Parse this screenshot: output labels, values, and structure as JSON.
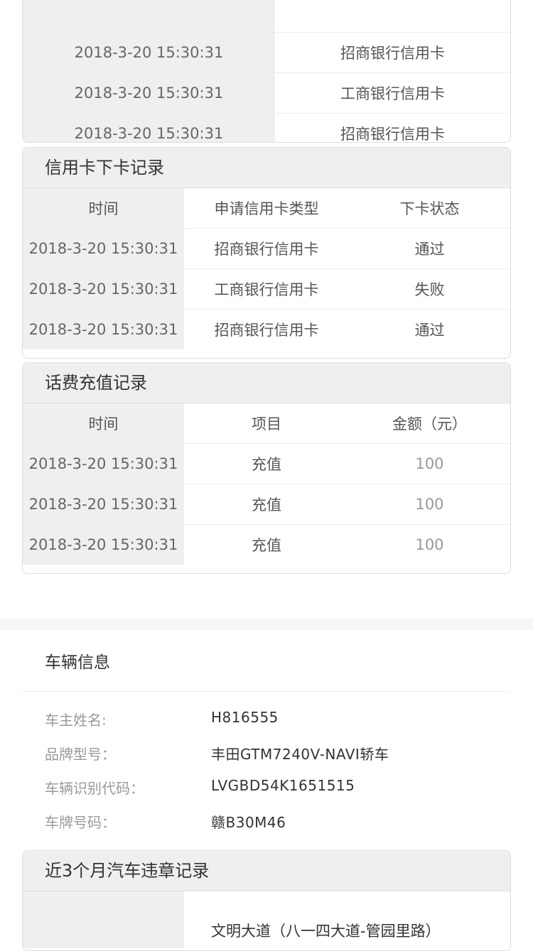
{
  "top_table": {
    "rows": [
      {
        "time": "2018-3-20  15:30:31",
        "bank": "招商银行信用卡"
      },
      {
        "time": "2018-3-20  15:30:31",
        "bank": "工商银行信用卡"
      },
      {
        "time": "2018-3-20  15:30:31",
        "bank": "招商银行信用卡"
      }
    ]
  },
  "credit_section": {
    "title": "信用卡下卡记录",
    "headers": [
      "时间",
      "申请信用卡类型",
      "下卡状态"
    ],
    "rows": [
      {
        "time": "2018-3-20  15:30:31",
        "type": "招商银行信用卡",
        "status": "通过"
      },
      {
        "time": "2018-3-20  15:30:31",
        "type": "工商银行信用卡",
        "status": "失败"
      },
      {
        "time": "2018-3-20  15:30:31",
        "type": "招商银行信用卡",
        "status": "通过"
      }
    ]
  },
  "recharge_section": {
    "title": "话费充值记录",
    "headers": [
      "时间",
      "项目",
      "金额（元）"
    ],
    "rows": [
      {
        "time": "2018-3-20  15:30:31",
        "item": "充值",
        "amount": "100"
      },
      {
        "time": "2018-3-20  15:30:31",
        "item": "充值",
        "amount": "100"
      },
      {
        "time": "2018-3-20  15:30:31",
        "item": "充值",
        "amount": "100"
      }
    ]
  },
  "vehicle": {
    "title": "车辆信息",
    "fields": [
      {
        "label": "车主姓名:",
        "value": "H816555"
      },
      {
        "label": "品牌型号：",
        "value": "丰田GTM7240V-NAVI轿车"
      },
      {
        "label": "车辆识别代码：",
        "value": "LVGBD54K1651515"
      },
      {
        "label": "车牌号码：",
        "value": "赣B30M46"
      }
    ]
  },
  "violation_section": {
    "title": "近3个月汽车违章记录",
    "first_row_place": "文明大道（八一四大道-管园里路）"
  },
  "colors": {
    "header_bg": "#efefef",
    "border": "#dddddd"
  }
}
